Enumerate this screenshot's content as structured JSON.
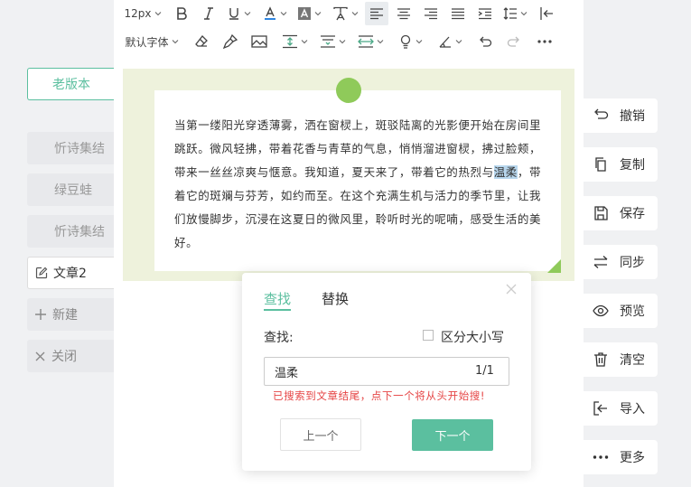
{
  "toolbar": {
    "font_size": "12px",
    "font_family": "默认字体"
  },
  "left_panel": {
    "old_version": "老版本",
    "items": [
      "忻诗集结",
      "绿豆蛙",
      "忻诗集结"
    ],
    "active_item": "文章2",
    "new_label": "新建",
    "close_label": "关闭"
  },
  "editor": {
    "text_before": "当第一缕阳光穿透薄雾，洒在窗棂上，斑驳陆离的光影便开始在房间里跳跃。微风轻拂，带着花香与青草的气息，悄悄溜进窗棂，拂过脸颊，带来一丝丝凉爽与惬意。我知道，夏天来了，带着它的热烈与",
    "highlight": "温柔",
    "text_after": "，带着它的斑斓与芬芳，如约而至。在这个充满生机与活力的季节里，让我们放慢脚步，沉浸在这夏日的微风里，聆听时光的呢喃，感受生活的美好。"
  },
  "right_panel": {
    "undo": "撤销",
    "copy": "复制",
    "save": "保存",
    "sync": "同步",
    "preview": "预览",
    "clear": "清空",
    "import": "导入",
    "more": "更多"
  },
  "find_dialog": {
    "tab_find": "查找",
    "tab_replace": "替换",
    "find_label": "查找:",
    "case_label": "区分大小写",
    "search_value": "温柔",
    "match_count": "1/1",
    "warning": "已搜索到文章结尾，点下一个将从头开始搜!",
    "prev_label": "上一个",
    "next_label": "下一个"
  },
  "colors": {
    "accent": "#5bbf9f",
    "warning": "#e64545",
    "paper_bg": "#eef2dc",
    "decor_green": "#8fca5a"
  }
}
